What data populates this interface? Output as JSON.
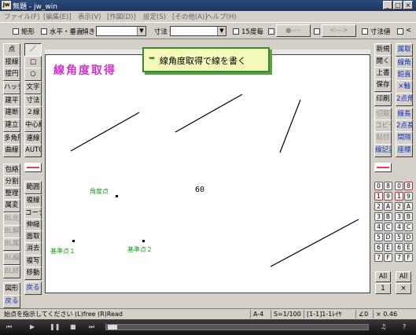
{
  "window": {
    "title": "無題 - jw_win"
  },
  "menu": [
    "ファイル(F)",
    "[編集(E)]",
    "表示(V)",
    "[作図(D)]",
    "設定(S)",
    "[その他(A)]",
    "ヘルプ(H)"
  ],
  "toolbar": {
    "rect_label": "矩形",
    "hv_label": "水平・垂直",
    "tilt_label": "傾き",
    "dim_label": "寸法",
    "angle15_label": "15度毎",
    "dot_label": "●----",
    "arrow_label": "<--->",
    "dimval_label": "寸法値"
  },
  "left_tools": {
    "col1": [
      "点",
      "接線",
      "接円",
      "ハッチ",
      "建平",
      "建断",
      "建立",
      "多角形",
      "曲線",
      "包絡",
      "分割",
      "整理",
      "属変",
      "BL化",
      "BL解",
      "BL属",
      "BL編",
      "BL終",
      "図形",
      "戻る"
    ],
    "col2": [
      "／",
      "□",
      "○",
      "文字",
      "寸法",
      "２線",
      "中心線",
      "連線",
      "AUTO",
      "",
      "範囲",
      "複線",
      "コーナー",
      "伸縮",
      "面取",
      "消去",
      "複写",
      "移動",
      "戻る"
    ]
  },
  "right_tools": {
    "col1": [
      "新規",
      "開く",
      "上書",
      "保存",
      "印刷",
      "切取",
      "コピー",
      "貼付",
      "線記変",
      "",
      "",
      ""
    ],
    "col2": [
      "属取",
      "線角",
      "鉛直",
      "×軸",
      "2点角",
      "線長",
      "2点長",
      "間隔",
      "座標"
    ]
  },
  "keypad": {
    "rows": [
      [
        "0",
        "8",
        "0",
        "8"
      ],
      [
        "1",
        "9",
        "1",
        "9"
      ],
      [
        "2",
        "A",
        "2",
        "A"
      ],
      [
        "3",
        "B",
        "3",
        "B"
      ],
      [
        "4",
        "C",
        "4",
        "C"
      ],
      [
        "5",
        "D",
        "5",
        "D"
      ],
      [
        "6",
        "E",
        "6",
        "E"
      ],
      [
        "7",
        "F",
        "7",
        "F"
      ]
    ],
    "all1": "All",
    "all2": "All",
    "one": "1",
    "cross": "×"
  },
  "drawing": {
    "heading": "線角度取得",
    "callout": "線角度取得で線を書く",
    "angle_point_label": "角度点",
    "angle_value": "60",
    "base_point_1": "基準点１",
    "base_point_2": "基準点２"
  },
  "status": {
    "message": "始点を指示してください (L)free (R)Read",
    "paper": "A-4",
    "scale": "S=1/100",
    "layer": "[1-1]1-1ﾚｲﾔ",
    "angle": "∠0",
    "zoom": "× 0.46"
  },
  "colors": {
    "heading": "#d030d0",
    "callout_bg": "#f4f8b8",
    "callout_border": "#3a8a2a",
    "annotation": "#1a9a1a"
  }
}
